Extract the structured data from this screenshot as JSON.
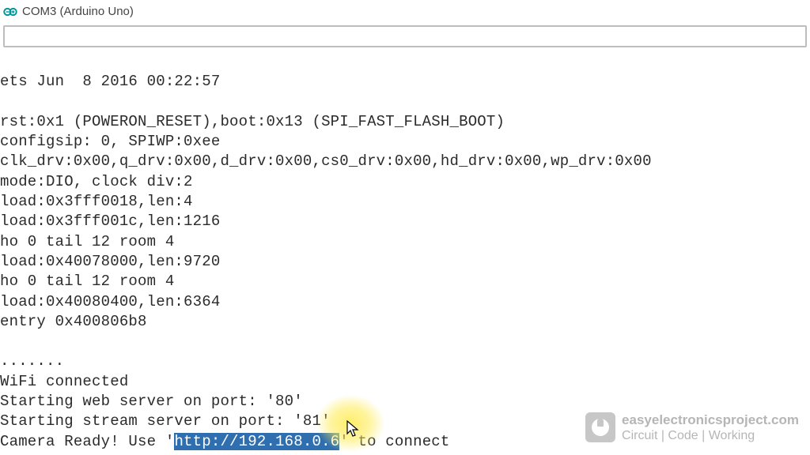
{
  "window": {
    "title": "COM3 (Arduino Uno)"
  },
  "input": {
    "value": "",
    "placeholder": ""
  },
  "lines": {
    "l0": "ets Jun  8 2016 00:22:57",
    "l1": "",
    "l2": "rst:0x1 (POWERON_RESET),boot:0x13 (SPI_FAST_FLASH_BOOT)",
    "l3": "configsip: 0, SPIWP:0xee",
    "l4": "clk_drv:0x00,q_drv:0x00,d_drv:0x00,cs0_drv:0x00,hd_drv:0x00,wp_drv:0x00",
    "l5": "mode:DIO, clock div:2",
    "l6": "load:0x3fff0018,len:4",
    "l7": "load:0x3fff001c,len:1216",
    "l8": "ho 0 tail 12 room 4",
    "l9": "load:0x40078000,len:9720",
    "l10": "ho 0 tail 12 room 4",
    "l11": "load:0x40080400,len:6364",
    "l12": "entry 0x400806b8",
    "l13": "",
    "l14": ".......",
    "l15": "WiFi connected",
    "l16": "Starting web server on port: '80'",
    "l17": "Starting stream server on port: '81'",
    "l18_pre": "Camera Ready! Use '",
    "l18_sel": "http://192.168.0.6",
    "l18_post": "' to connect"
  },
  "watermark": {
    "top": "easyelectronicsproject.com",
    "bottom": "Circuit | Code | Working"
  }
}
